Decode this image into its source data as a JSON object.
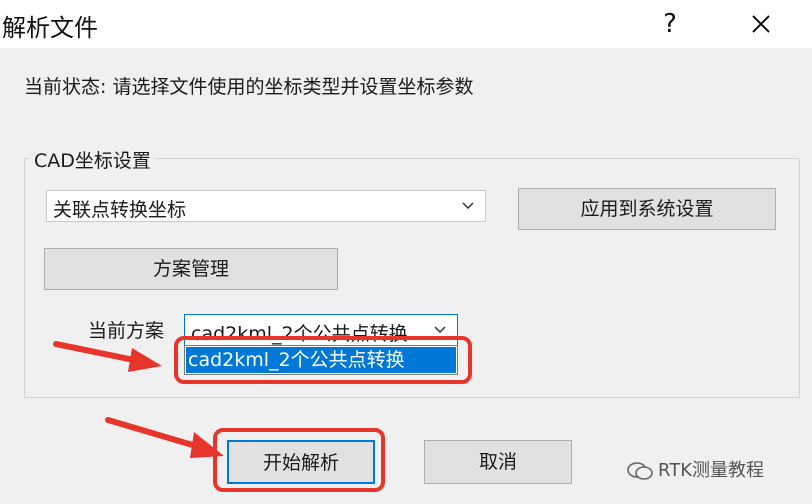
{
  "window": {
    "title": "解析文件",
    "help_glyph": "?",
    "close_glyph": "✕"
  },
  "status_text": "当前状态: 请选择文件使用的坐标类型并设置坐标参数",
  "cad_group": {
    "legend": "CAD坐标设置",
    "coord_mode": {
      "selected": "关联点转换坐标"
    },
    "apply_button": "应用到系统设置",
    "plan_manage_button": "方案管理",
    "current_plan_label": "当前方案",
    "current_plan": {
      "selected": "cad2kml_2个公共点转换",
      "options": [
        "cad2kml_2个公共点转换"
      ]
    }
  },
  "actions": {
    "start_button": "开始解析",
    "cancel_button": "取消"
  },
  "watermark": "RTK测量教程",
  "colors": {
    "annotation": "#e8352b",
    "selection": "#0078d7",
    "dialog_bg": "#f0f0f0"
  }
}
